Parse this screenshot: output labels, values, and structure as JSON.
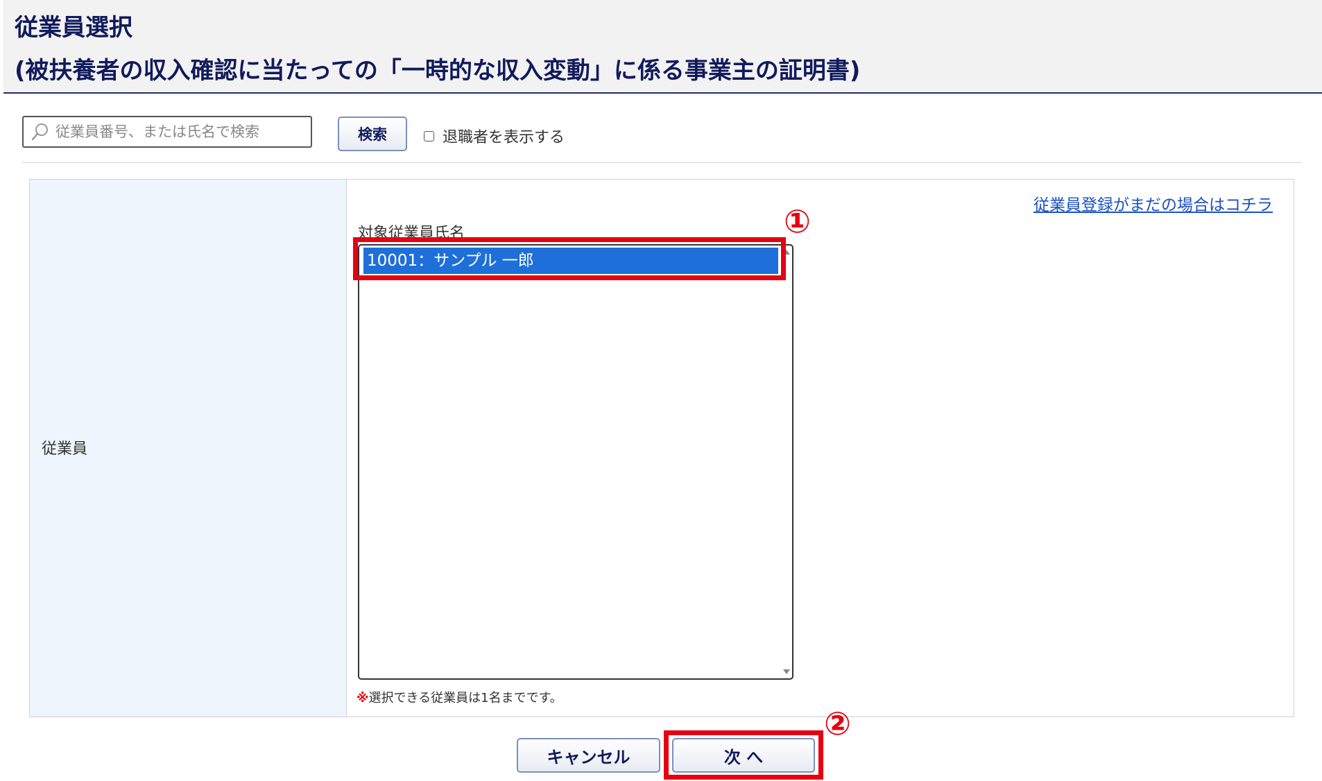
{
  "header": {
    "title_line1": "従業員選択",
    "title_line2": "(被扶養者の収入確認に当たっての「一時的な収入変動」に係る事業主の証明書)"
  },
  "search": {
    "placeholder": "従業員番号、または氏名で検索",
    "button_label": "検索",
    "show_retired_label": "退職者を表示する",
    "show_retired_checked": false
  },
  "form": {
    "row_label": "従業員",
    "register_link": "従業員登録がまだの場合はコチラ",
    "list_caption": "対象従業員氏名",
    "options": [
      "10001：サンプル 一郎"
    ],
    "selected_option": "10001：サンプル 一郎",
    "note_mark": "※",
    "note_text": "選択できる従業員は1名までです。"
  },
  "actions": {
    "cancel_label": "キャンセル",
    "next_label": "次 へ"
  },
  "annotations": {
    "step1": "①",
    "step2": "②",
    "highlight_color": "#e60012"
  },
  "colors": {
    "title": "#111a5c",
    "selected_option_bg": "#1e6fd9",
    "label_cell_bg": "#eef5fc",
    "link": "#1a4fc4"
  },
  "icons": {
    "search": "search-icon"
  }
}
